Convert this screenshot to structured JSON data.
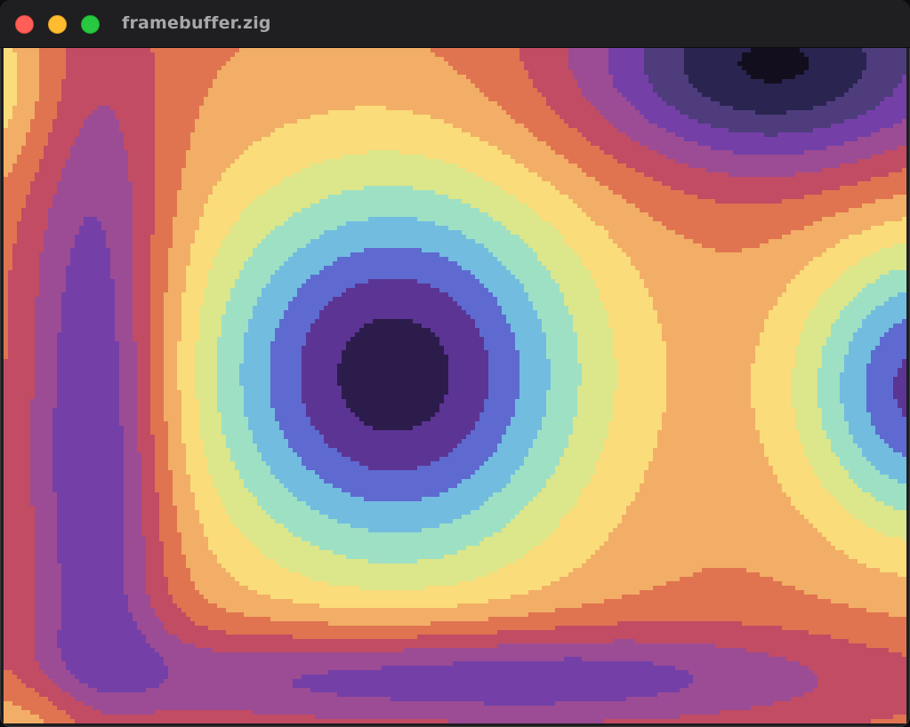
{
  "window": {
    "title": "framebuffer.zig"
  },
  "palette": [
    "#2c1c4c",
    "#5c3494",
    "#5e6ad0",
    "#72bce0",
    "#9ee0c4",
    "#dce68a",
    "#fadc7a",
    "#f2ae66",
    "#e07450",
    "#c24c64",
    "#9c4c94",
    "#7440a8",
    "#4e3c7c",
    "#2a2450",
    "#120e1e"
  ]
}
